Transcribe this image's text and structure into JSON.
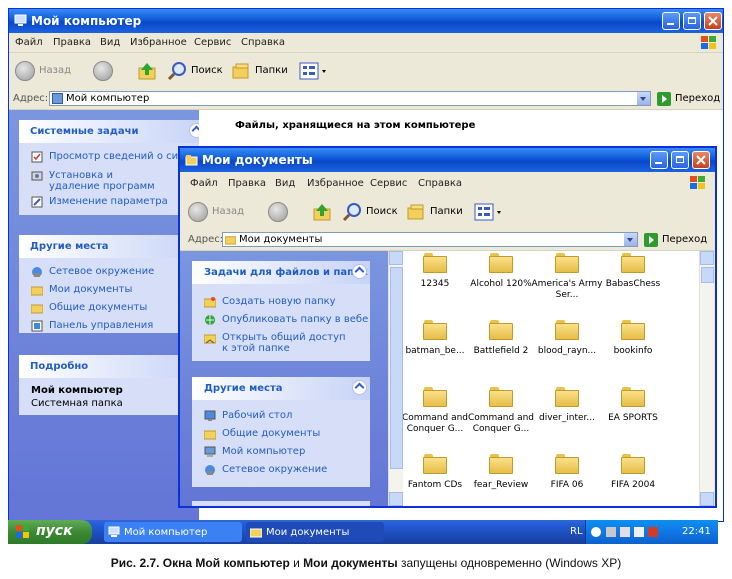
{
  "win1": {
    "title": "Мой компьютер",
    "menu": [
      "Файл",
      "Правка",
      "Вид",
      "Избранное",
      "Сервис",
      "Справка"
    ],
    "toolbar": {
      "back": "Назад",
      "search": "Поиск",
      "folders": "Папки"
    },
    "address": {
      "label": "Адрес:",
      "value": "Мой компьютер",
      "go": "Переход"
    },
    "content_heading": "Файлы, хранящиеся на этом компьютере",
    "panels": {
      "system": {
        "title": "Системные задачи",
        "items": [
          "Просмотр сведений о системе",
          "Установка и удаление программ",
          "Изменение параметра"
        ]
      },
      "places": {
        "title": "Другие места",
        "items": [
          "Сетевое окружение",
          "Мои документы",
          "Общие документы",
          "Панель управления"
        ]
      },
      "details": {
        "title": "Подробно",
        "name": "Мой компьютер",
        "desc": "Системная папка"
      }
    }
  },
  "win2": {
    "title": "Мои документы",
    "menu": [
      "Файл",
      "Правка",
      "Вид",
      "Избранное",
      "Сервис",
      "Справка"
    ],
    "toolbar": {
      "back": "Назад",
      "search": "Поиск",
      "folders": "Папки"
    },
    "address": {
      "label": "Адрес:",
      "value": "Мои документы",
      "go": "Переход"
    },
    "panels": {
      "tasks": {
        "title": "Задачи для файлов и папок",
        "items": [
          "Создать новую папку",
          "Опубликовать папку в вебе",
          "Открыть общий доступ к этой папке"
        ]
      },
      "places": {
        "title": "Другие места",
        "items": [
          "Рабочий стол",
          "Общие документы",
          "Мой компьютер",
          "Сетевое окружение"
        ]
      }
    },
    "folders": [
      "12345",
      "Alcohol 120%",
      "America's Army Ser...",
      "BabasChess",
      "batman_be...",
      "Battlefield 2",
      "blood_rayn...",
      "bookinfo",
      "Command and Conquer G...",
      "Command and Conquer G...",
      "diver_inter...",
      "EA SPORTS",
      "Fantom CDs",
      "fear_Review",
      "FIFA 06",
      "FIFA 2004"
    ]
  },
  "taskbar": {
    "start": "пуск",
    "tasks": [
      "Мой компьютер",
      "Мои документы"
    ],
    "lang": "RL",
    "clock": "22:41"
  },
  "caption": {
    "prefix": "Рис. 2.7. Окна ",
    "name1": "Мой компьютер",
    "mid": " и ",
    "name2": "Мои документы",
    "suffix": " запущены одновременно (Windows XP)"
  }
}
